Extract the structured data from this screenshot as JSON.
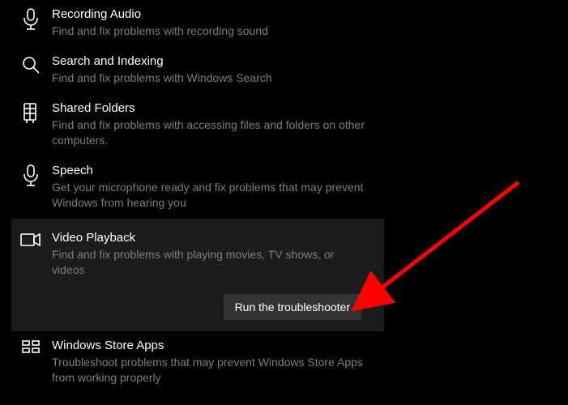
{
  "items": [
    {
      "title": "Recording Audio",
      "desc": "Find and fix problems with recording sound"
    },
    {
      "title": "Search and Indexing",
      "desc": "Find and fix problems with Windows Search"
    },
    {
      "title": "Shared Folders",
      "desc": "Find and fix problems with accessing files and folders on other computers."
    },
    {
      "title": "Speech",
      "desc": "Get your microphone ready and fix problems that may prevent Windows from hearing you"
    },
    {
      "title": "Video Playback",
      "desc": "Find and fix problems with playing movies, TV shows, or videos"
    },
    {
      "title": "Windows Store Apps",
      "desc": "Troubleshoot problems that may prevent Windows Store Apps from working properly"
    }
  ],
  "run_button_label": "Run the troubleshooter"
}
